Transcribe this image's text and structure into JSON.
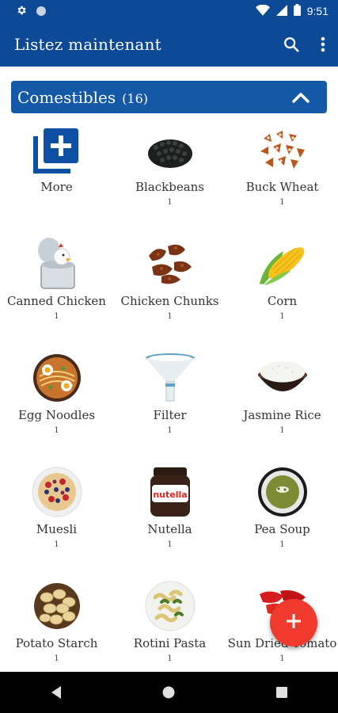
{
  "status_bar": {
    "time": "9:51",
    "icons": [
      "gear-icon",
      "circle-icon",
      "wifi-icon",
      "signal-icon",
      "battery-icon"
    ]
  },
  "app_bar": {
    "title": "Listez maintenant",
    "actions": [
      "search-icon",
      "more-vert-icon"
    ]
  },
  "category": {
    "label": "Comestibles",
    "count": "(16)",
    "expanded_icon": "chevron-up-icon"
  },
  "items": [
    {
      "name": "More",
      "qty": "",
      "icon": "add-box-icon"
    },
    {
      "name": "Blackbeans",
      "qty": "1",
      "icon": "blackbeans-image"
    },
    {
      "name": "Buck Wheat",
      "qty": "1",
      "icon": "buckwheat-image"
    },
    {
      "name": "Canned Chicken",
      "qty": "1",
      "icon": "canned-chicken-image"
    },
    {
      "name": "Chicken Chunks",
      "qty": "1",
      "icon": "chicken-chunks-image"
    },
    {
      "name": "Corn",
      "qty": "1",
      "icon": "corn-image"
    },
    {
      "name": "Egg Noodles",
      "qty": "1",
      "icon": "egg-noodles-image"
    },
    {
      "name": "Filter",
      "qty": "1",
      "icon": "filter-image"
    },
    {
      "name": "Jasmine Rice",
      "qty": "1",
      "icon": "jasmine-rice-image"
    },
    {
      "name": "Muesli",
      "qty": "1",
      "icon": "muesli-image"
    },
    {
      "name": "Nutella",
      "qty": "1",
      "icon": "nutella-image"
    },
    {
      "name": "Pea Soup",
      "qty": "1",
      "icon": "pea-soup-image"
    },
    {
      "name": "Potato Starch",
      "qty": "1",
      "icon": "potato-starch-image"
    },
    {
      "name": "Rotini Pasta",
      "qty": "1",
      "icon": "rotini-pasta-image"
    },
    {
      "name": "Sun Dried Tomato",
      "qty": "1",
      "icon": "sun-dried-tomato-image"
    }
  ],
  "nutella_label": "nutella",
  "fab": {
    "icon": "plus-icon"
  },
  "nav_bar": {
    "buttons": [
      "back-icon",
      "home-icon",
      "recents-icon"
    ]
  },
  "colors": {
    "primary": "#0c4a97",
    "category_bar": "#1458a8",
    "fab": "#f03a2e"
  }
}
